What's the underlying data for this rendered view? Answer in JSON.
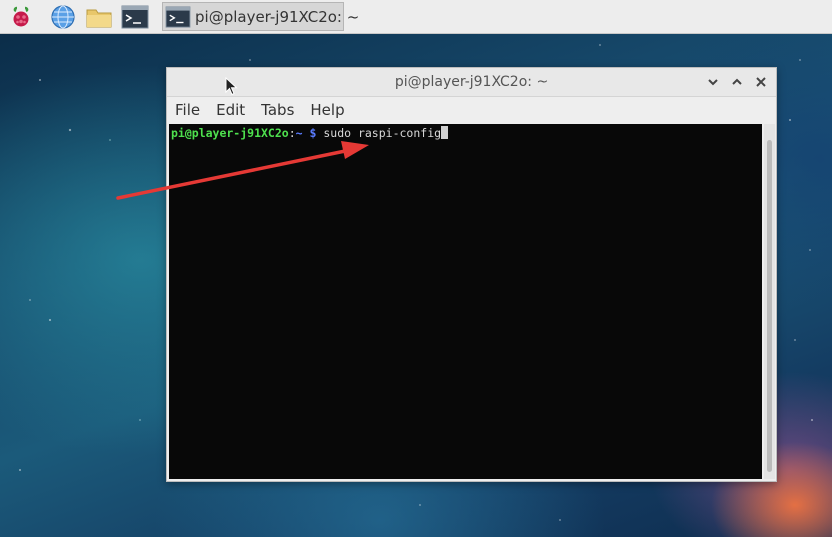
{
  "taskbar": {
    "launchers": [
      "raspberry-menu",
      "web-browser",
      "file-manager",
      "terminal"
    ],
    "task": {
      "label": "pi@player-j91XC2o: ~"
    }
  },
  "window": {
    "title": "pi@player-j91XC2o: ~",
    "menu": [
      "File",
      "Edit",
      "Tabs",
      "Help"
    ],
    "terminal": {
      "prompt_user": "pi@player-j91XC2o",
      "prompt_sep": ":",
      "prompt_path": "~ $",
      "command": " sudo raspi-config"
    }
  },
  "annotation": {
    "color": "#e53935"
  }
}
